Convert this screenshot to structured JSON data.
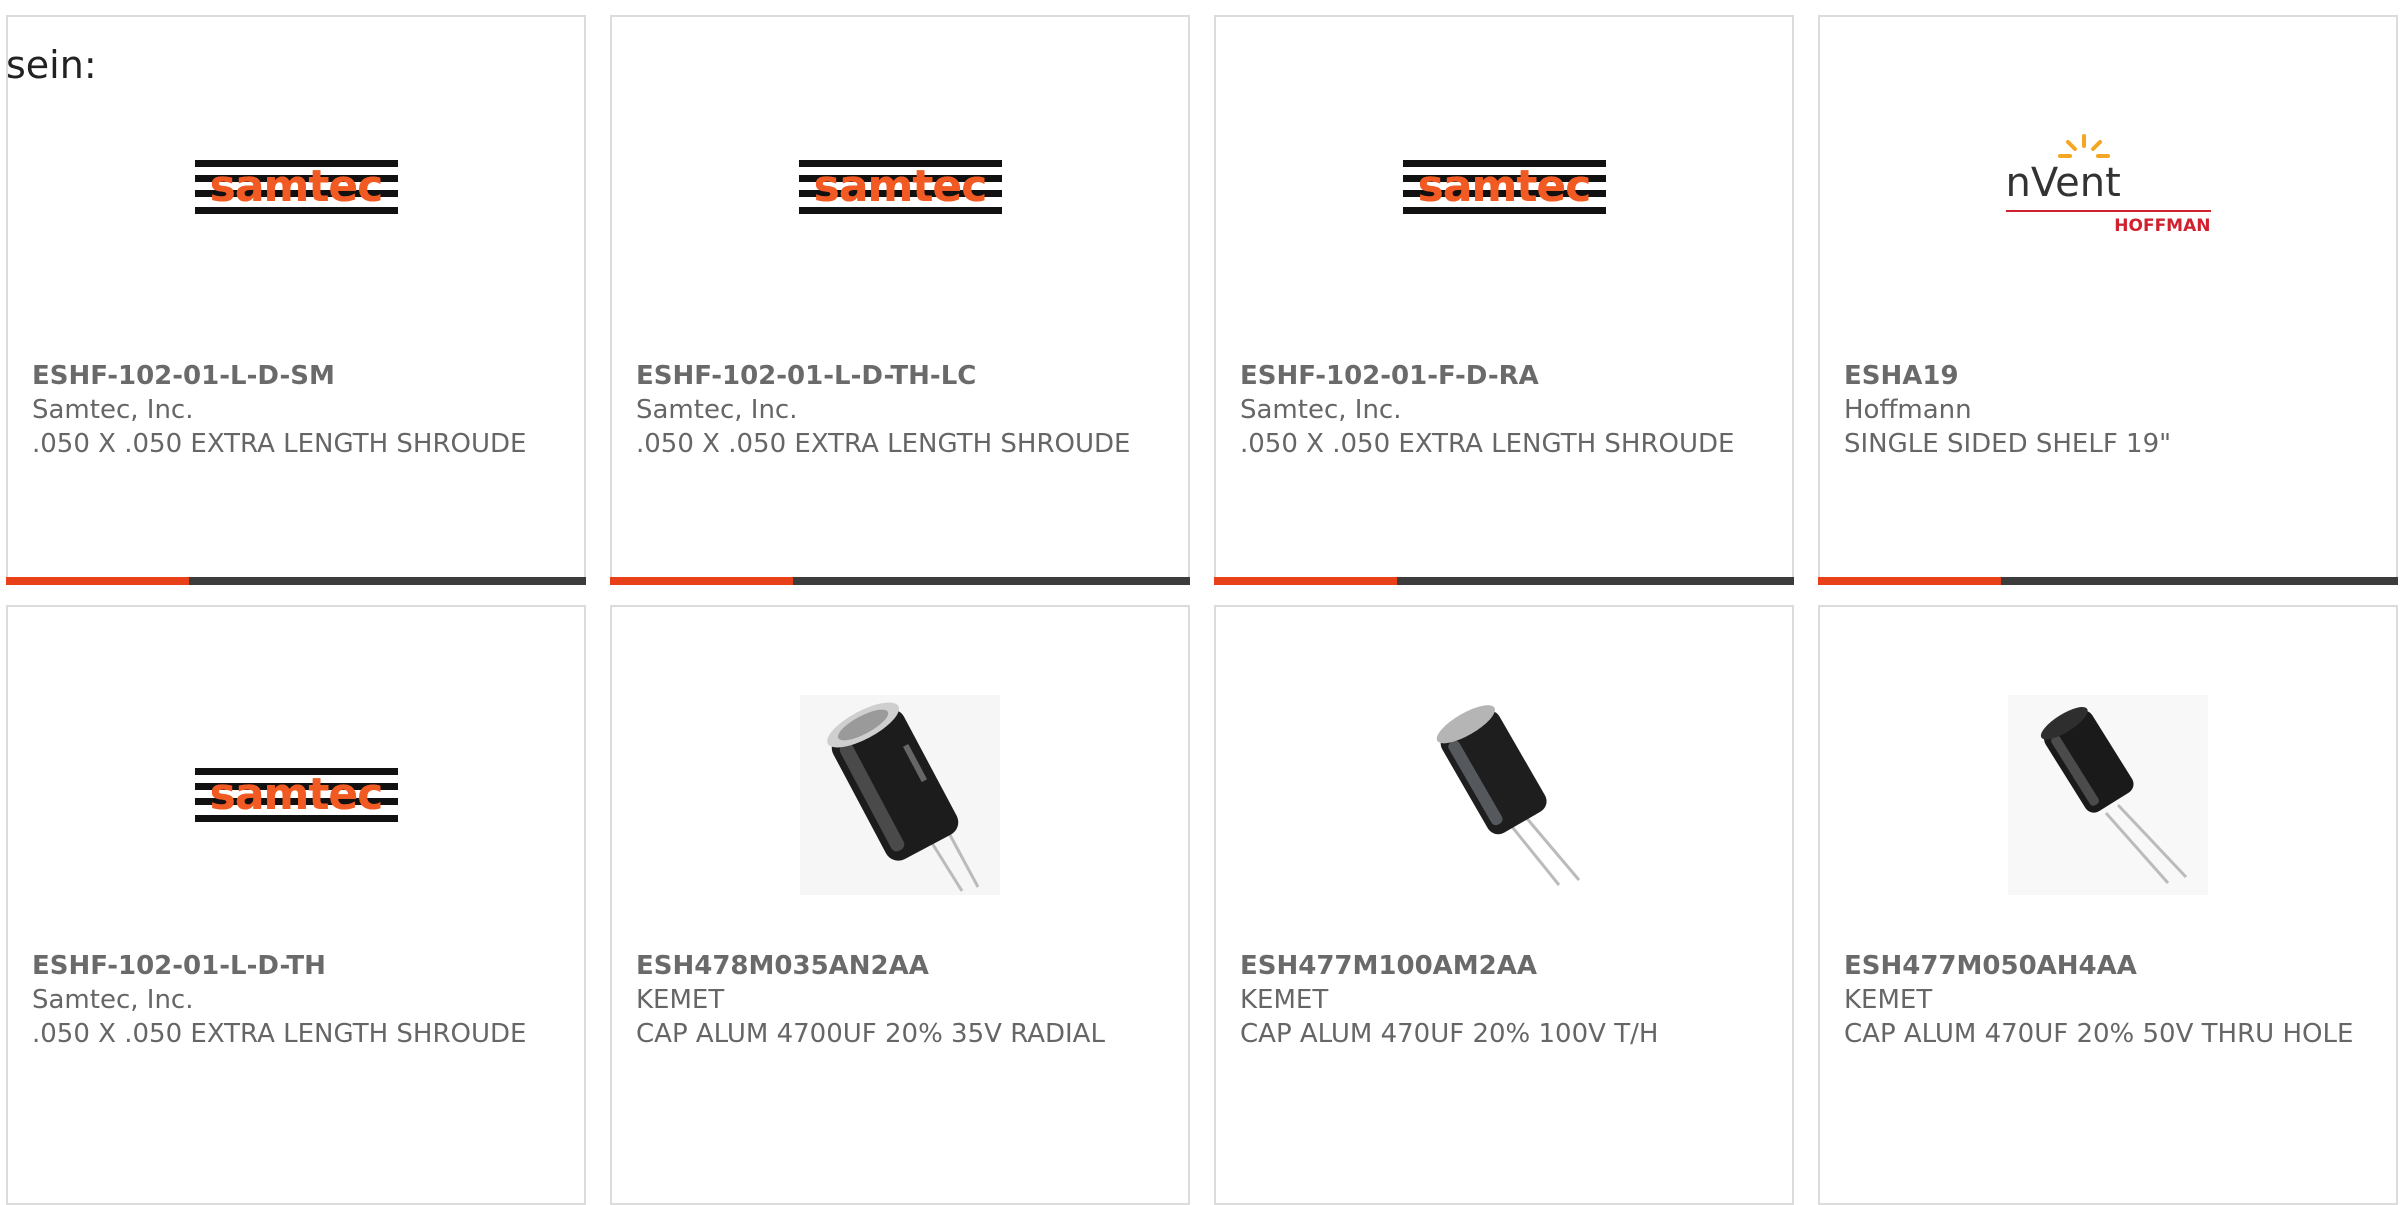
{
  "prefix_text": "sein:",
  "colors": {
    "accent": "#e8411a",
    "bar": "#3c3c3c",
    "samtec_orange": "#f15a22",
    "nvent_red": "#d0212f"
  },
  "logos": {
    "samtec": "samtec",
    "nvent": "nVent",
    "hoffman": "HOFFMAN"
  },
  "products": [
    {
      "pn": "ESHF-102-01-L-D-SM",
      "mfr": "Samtec, Inc.",
      "desc": ".050 X .050 EXTRA LENGTH SHROUDE",
      "image": "samtec-logo"
    },
    {
      "pn": "ESHF-102-01-L-D-TH-LC",
      "mfr": "Samtec, Inc.",
      "desc": ".050 X .050 EXTRA LENGTH SHROUDE",
      "image": "samtec-logo"
    },
    {
      "pn": "ESHF-102-01-F-D-RA",
      "mfr": "Samtec, Inc.",
      "desc": ".050 X .050 EXTRA LENGTH SHROUDE",
      "image": "samtec-logo"
    },
    {
      "pn": "ESHA19",
      "mfr": "Hoffmann",
      "desc": "SINGLE SIDED SHELF 19\"",
      "image": "nvent-hoffman-logo"
    },
    {
      "pn": "ESHF-102-01-L-D-TH",
      "mfr": "Samtec, Inc.",
      "desc": ".050 X .050 EXTRA LENGTH SHROUDE",
      "image": "samtec-logo"
    },
    {
      "pn": "ESH478M035AN2AA",
      "mfr": "KEMET",
      "desc": "CAP ALUM 4700UF 20% 35V RADIAL",
      "image": "capacitor-photo"
    },
    {
      "pn": "ESH477M100AM2AA",
      "mfr": "KEMET",
      "desc": "CAP ALUM 470UF 20% 100V T/H",
      "image": "capacitor-photo"
    },
    {
      "pn": "ESH477M050AH4AA",
      "mfr": "KEMET",
      "desc": "CAP ALUM 470UF 20% 50V THRU HOLE",
      "image": "capacitor-photo"
    }
  ]
}
